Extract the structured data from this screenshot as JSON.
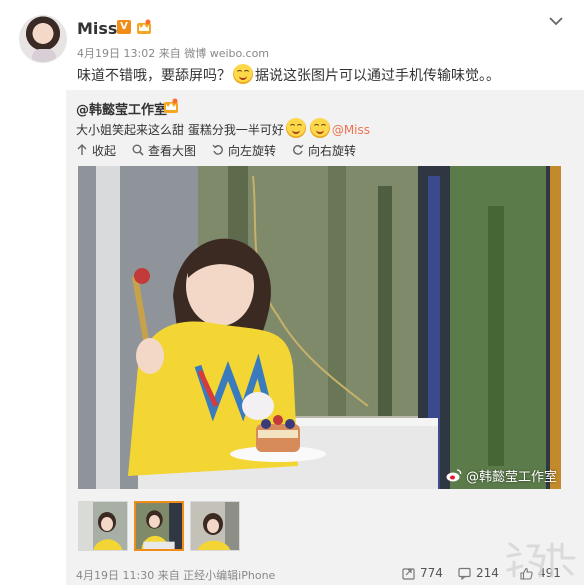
{
  "post": {
    "username": "Miss",
    "verified_badge": "V",
    "time": "4月19日 13:02",
    "source": "来自 微博 weibo.com",
    "text_before_emoji": "味道不错哦，要舔屏吗？",
    "text_after_emoji": "据说这张图片可以通过手机传输味觉。。",
    "emoji_icon": "smile-emoji-icon"
  },
  "repost": {
    "author": "@韩懿莹工作室",
    "text": "大小姐笑起来这么甜 蛋糕分我一半可好",
    "mention": "@Miss",
    "actions": [
      "收起",
      "查看大图",
      "向左旋转",
      "向右旋转"
    ],
    "photo_watermark": "@韩懿莹工作室",
    "footer_meta": "4月19日 11:30 来自 正经小编辑iPhone",
    "repost_count": "774",
    "comment_count": "214",
    "like_count": "491"
  },
  "colors": {
    "accent": "#f08c17",
    "mention": "#eb7350",
    "repost_bg": "#f2f2f2",
    "muted_text": "#888888"
  }
}
